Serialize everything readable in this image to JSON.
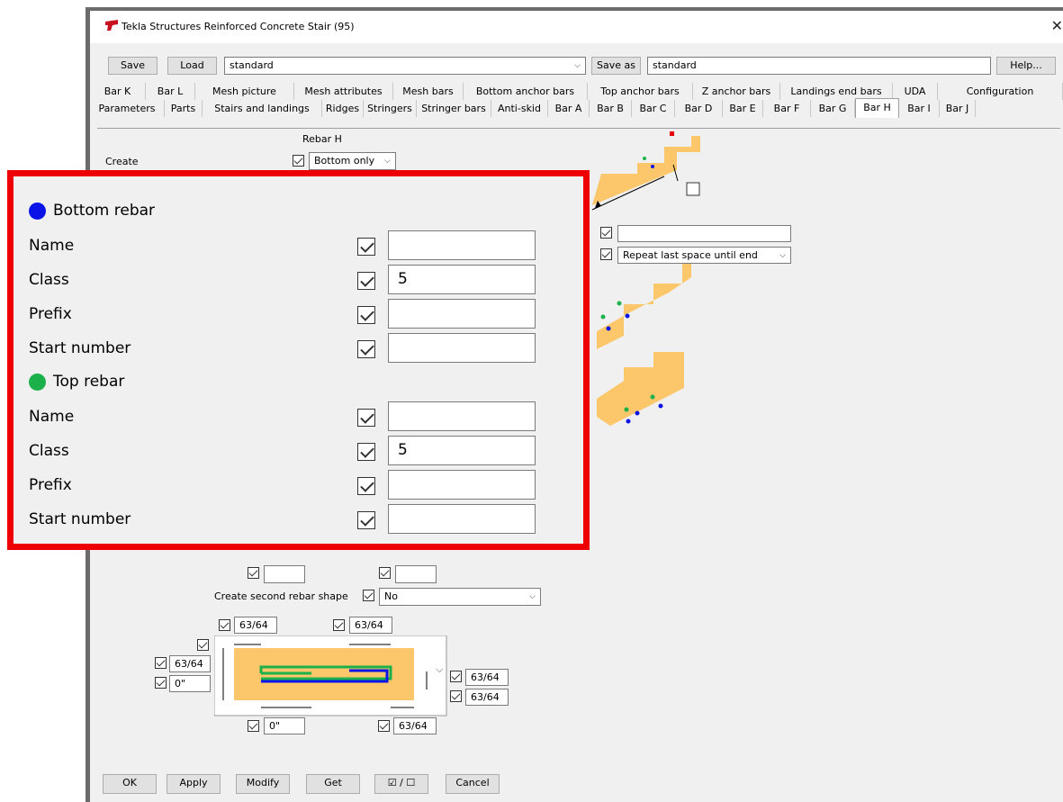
{
  "window": {
    "title": "Tekla Structures  Reinforced Concrete Stair (95)",
    "close_glyph": "✕"
  },
  "toolbar": {
    "save_label": "Save",
    "load_label": "Load",
    "preset_value": "standard",
    "save_as_label": "Save as",
    "save_as_value": "standard",
    "help_label": "Help..."
  },
  "tabs_row1": [
    "Bar K",
    "Bar L",
    "Mesh picture",
    "Mesh attributes",
    "Mesh bars",
    "Bottom anchor bars",
    "Top anchor bars",
    "Z anchor bars",
    "Landings end bars",
    "UDA",
    "Configuration"
  ],
  "tabs_row2": [
    "Parameters",
    "Parts",
    "Stairs and landings",
    "Ridges",
    "Stringers",
    "Stringer bars",
    "Anti-skid",
    "Bar A",
    "Bar B",
    "Bar C",
    "Bar D",
    "Bar E",
    "Bar F",
    "Bar G",
    "Bar H",
    "Bar I",
    "Bar J"
  ],
  "active_tab": "Bar H",
  "panel": {
    "rebar_h_label": "Rebar H",
    "create_label": "Create",
    "create_value": "Bottom only",
    "spacing_value": "Repeat last space until end",
    "second_shape_label": "Create second rebar shape",
    "second_shape_value": "No",
    "dim_values": {
      "top_left": "63/64",
      "top_right": "63/64",
      "left_upper": "63/64",
      "left_lower": "0\"",
      "right_upper": "63/64",
      "right_lower": "63/64",
      "bottom_left": "0\"",
      "bottom_right": "63/64"
    }
  },
  "overlay": {
    "bottom_header": "Bottom rebar",
    "top_header": "Top rebar",
    "bottom_color": "#0a14e6",
    "top_color": "#1cb04a",
    "bottom_rows": [
      {
        "label": "Name",
        "value": ""
      },
      {
        "label": "Class",
        "value": "5"
      },
      {
        "label": "Prefix",
        "value": ""
      },
      {
        "label": "Start number",
        "value": ""
      }
    ],
    "top_rows": [
      {
        "label": "Name",
        "value": ""
      },
      {
        "label": "Class",
        "value": "5"
      },
      {
        "label": "Prefix",
        "value": ""
      },
      {
        "label": "Start number",
        "value": ""
      }
    ]
  },
  "bottom_bar": {
    "ok_label": "OK",
    "apply_label": "Apply",
    "modify_label": "Modify",
    "get_label": "Get",
    "toggle_label": "☑ / ☐",
    "cancel_label": "Cancel"
  },
  "colors": {
    "accent_red": "#ee0000",
    "concrete": "#fcc76a"
  }
}
